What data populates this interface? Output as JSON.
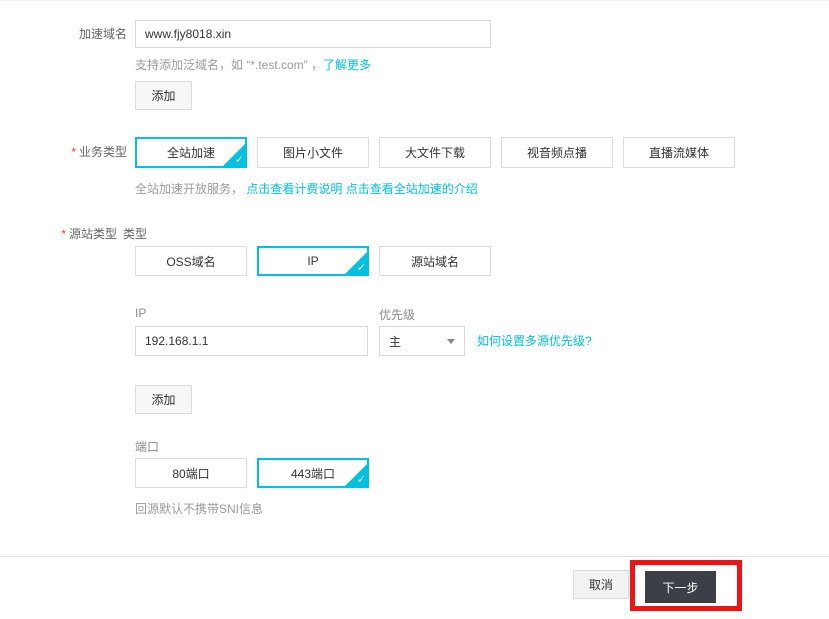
{
  "colors": {
    "accent": "#00C1DE",
    "link": "#00C1DE",
    "required_mark": "#F04134",
    "next_button_bg": "#3A4045",
    "annotation_highlight": "#EC1414"
  },
  "domain_section": {
    "label": "加速域名",
    "input_value": "www.fjy8018.xin",
    "help_prefix": "支持添加泛域名，如 “*.test.com” ，",
    "help_link": "了解更多",
    "add_button": "添加"
  },
  "business_section": {
    "required_mark": "*",
    "label": "业务类型",
    "options": [
      {
        "label": "全站加速",
        "selected": true
      },
      {
        "label": "图片小文件",
        "selected": false
      },
      {
        "label": "大文件下载",
        "selected": false
      },
      {
        "label": "视音频点播",
        "selected": false
      },
      {
        "label": "直播流媒体",
        "selected": false
      }
    ],
    "help_prefix": "全站加速开放服务，",
    "help_link_billing": "点击查看计费说明",
    "help_link_intro": "点击查看全站加速的介绍"
  },
  "origin_section": {
    "required_mark": "*",
    "label": "源站类型",
    "type_label": "类型",
    "type_options": [
      {
        "label": "OSS域名",
        "selected": false
      },
      {
        "label": "IP",
        "selected": true
      },
      {
        "label": "源站域名",
        "selected": false
      }
    ],
    "ip_label": "IP",
    "ip_value": "192.168.1.1",
    "priority_label": "优先级",
    "priority_value": "主",
    "priority_help_link": "如何设置多源优先级?",
    "add_button": "添加",
    "port_label": "端口",
    "port_options": [
      {
        "label": "80端口",
        "selected": false
      },
      {
        "label": "443端口",
        "selected": true
      }
    ],
    "sni_note": "回源默认不携带SNI信息"
  },
  "footer": {
    "cancel_button": "取消",
    "next_button": "下一步"
  }
}
